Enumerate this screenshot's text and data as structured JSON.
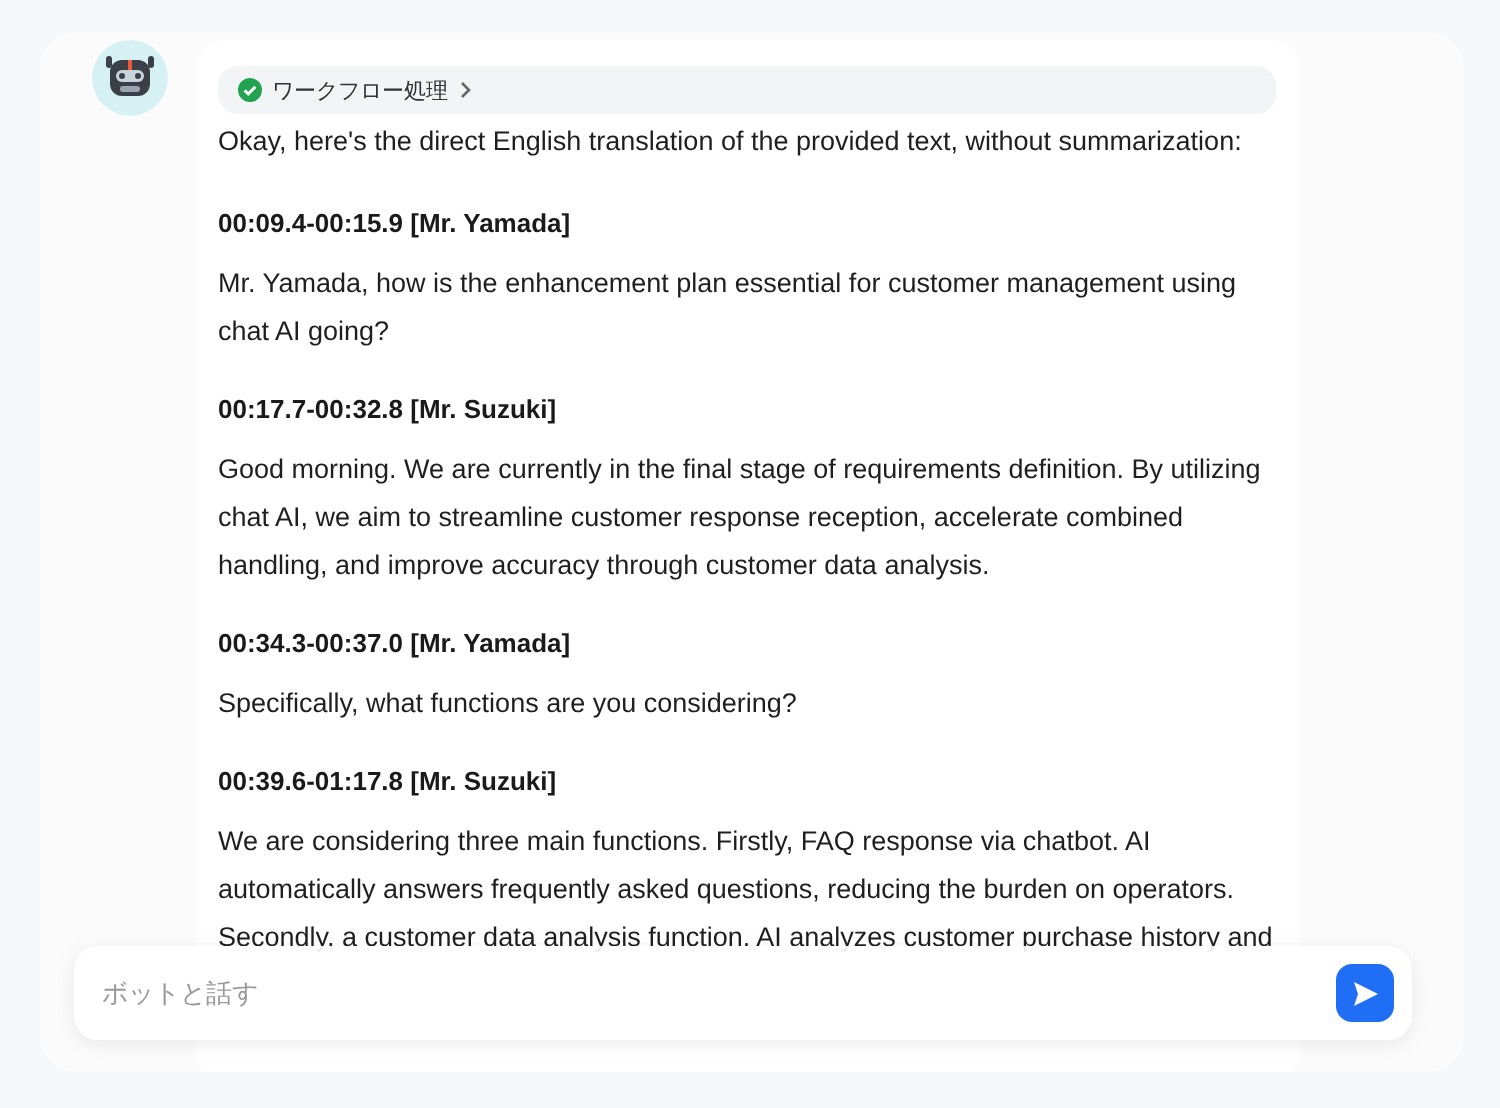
{
  "workflow_chip": {
    "label": "ワークフロー処理"
  },
  "message": {
    "intro": "Okay, here's the direct English translation of the provided text, without summarization:",
    "segments": [
      {
        "header": "00:09.4-00:15.9 [Mr. Yamada]",
        "text": "Mr. Yamada, how is the enhancement plan essential for customer management using chat AI going?"
      },
      {
        "header": "00:17.7-00:32.8 [Mr. Suzuki]",
        "text": "Good morning. We are currently in the final stage of requirements definition. By utilizing chat AI, we aim to streamline customer response reception, accelerate combined handling, and improve accuracy through customer data analysis."
      },
      {
        "header": "00:34.3-00:37.0 [Mr. Yamada]",
        "text": "Specifically, what functions are you considering?"
      },
      {
        "header": "00:39.6-01:17.8 [Mr. Suzuki]",
        "text": "We are considering three main functions. Firstly, FAQ response via chatbot. AI automatically answers frequently asked questions, reducing the burden on operators. Secondly, a customer data analysis function. AI analyzes customer purchase history and"
      }
    ]
  },
  "input": {
    "placeholder": "ボットと話す"
  }
}
